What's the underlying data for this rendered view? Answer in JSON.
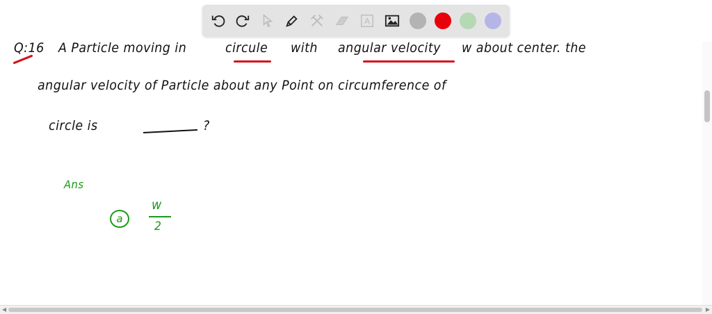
{
  "toolbar": {
    "tools": [
      "undo-icon",
      "redo-icon",
      "pointer-icon",
      "pen-icon",
      "tools-icon",
      "eraser-icon",
      "text-icon",
      "image-icon"
    ],
    "colors": [
      "#b3b3b3",
      "#e8000b",
      "#b5d8b5",
      "#b5b5e8"
    ]
  },
  "question": {
    "number": "Q:16",
    "line1": [
      "A Particle moving in",
      "circule",
      "with",
      "angular velocity",
      "w about center. the"
    ],
    "line2": "angular velocity of Particle about any Point on circumference of",
    "line3_start": "circle is",
    "line3_end": "?"
  },
  "answer": {
    "label": "Ans",
    "option": "a",
    "numerator": "w",
    "denominator": "2"
  }
}
